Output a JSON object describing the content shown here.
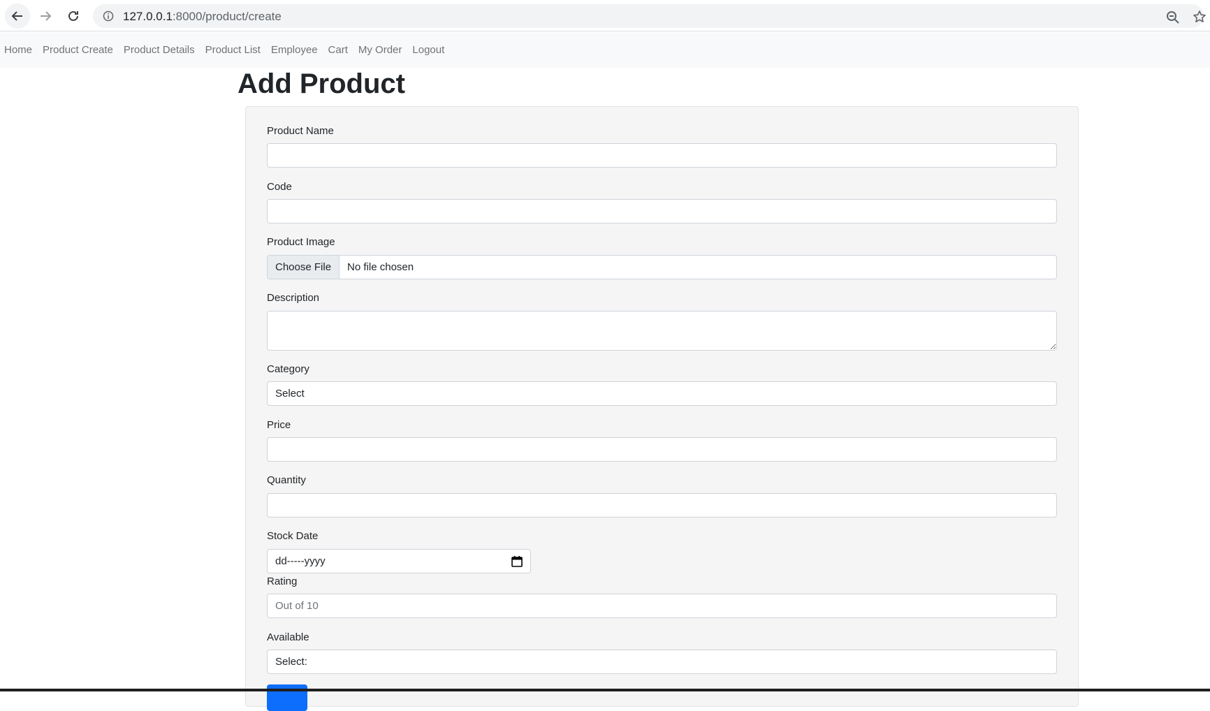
{
  "browser": {
    "url_host": "127.0.0.1",
    "url_path": ":8000/product/create"
  },
  "nav": {
    "items": [
      "Home",
      "Product Create",
      "Product Details",
      "Product List",
      "Employee",
      "Cart",
      "My Order",
      "Logout"
    ]
  },
  "page": {
    "title": "Add Product"
  },
  "form": {
    "product_name_label": "Product Name",
    "code_label": "Code",
    "image_label": "Product Image",
    "image_button": "Choose File",
    "image_status": "No file chosen",
    "description_label": "Description",
    "category_label": "Category",
    "category_value": "Select",
    "price_label": "Price",
    "quantity_label": "Quantity",
    "stock_date_label": "Stock Date",
    "stock_date_value": "dd-----yyyy",
    "rating_label": "Rating",
    "rating_placeholder": "Out of 10",
    "available_label": "Available",
    "available_value": "Select:"
  },
  "colors": {
    "primary": "#0d6efd",
    "nav_bg": "#f8f9fa",
    "card_bg": "#f5f5f5"
  }
}
